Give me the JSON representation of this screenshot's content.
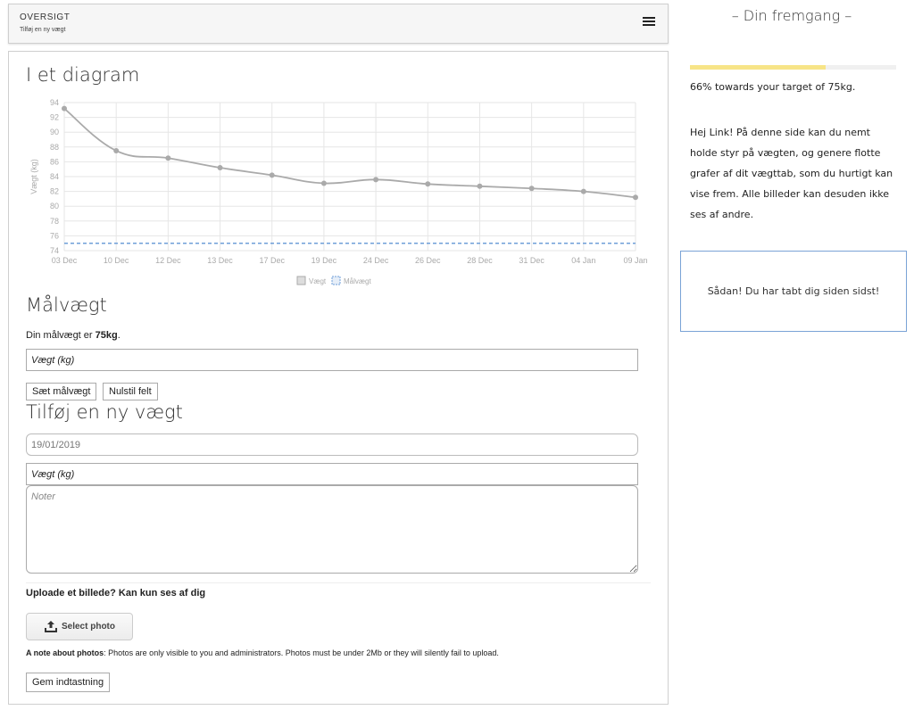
{
  "header": {
    "title": "OVERSIGT",
    "subtitle": "Tilføj en ny vægt"
  },
  "chart_section": {
    "title": "I et diagram"
  },
  "chart_data": {
    "type": "line",
    "ylabel": "Vægt (kg)",
    "ylim": [
      74,
      94
    ],
    "yticks": [
      74,
      76,
      78,
      80,
      82,
      84,
      86,
      88,
      90,
      92,
      94
    ],
    "categories": [
      "03 Dec",
      "10 Dec",
      "12 Dec",
      "13 Dec",
      "17 Dec",
      "19 Dec",
      "24 Dec",
      "26 Dec",
      "28 Dec",
      "31 Dec",
      "04 Jan",
      "09 Jan"
    ],
    "series": [
      {
        "name": "Vægt",
        "values": [
          93.2,
          87.5,
          86.5,
          85.2,
          84.2,
          83.1,
          83.6,
          83.0,
          82.7,
          82.4,
          82.0,
          81.2
        ],
        "color": "#aaaaaa"
      },
      {
        "name": "Målvægt",
        "values": [
          75,
          75,
          75,
          75,
          75,
          75,
          75,
          75,
          75,
          75,
          75,
          75
        ],
        "color": "#6f9fd8",
        "style": "dashed"
      }
    ],
    "grid": true,
    "legend_position": "bottom"
  },
  "goal": {
    "title": "Målvægt",
    "text_prefix": "Din målvægt er ",
    "value": "75kg",
    "text_suffix": ".",
    "input_placeholder": "Vægt (kg)",
    "set_button": "Sæt målvægt",
    "reset_button": "Nulstil felt"
  },
  "add_weight": {
    "title": "Tilføj en ny vægt",
    "date_value": "19/01/2019",
    "weight_placeholder": "Vægt (kg)",
    "notes_placeholder": "Noter",
    "upload_label": "Uploade et billede? Kan kun ses af dig",
    "photo_button": "Select photo",
    "note_bold": "A note about photos",
    "note_text": ": Photos are only visible to you and administrators. Photos must be under 2Mb or they will silently fail to upload.",
    "save_button": "Gem indtastning"
  },
  "sidebar": {
    "title": "– Din fremgang –",
    "progress_fraction": 0.66,
    "progress_text": "66% towards your target of 75kg.",
    "intro": "Hej Link! På denne side kan du nemt holde styr på vægten, og genere flotte grafer af dit vægttab, som du hurtigt kan vise frem. Alle billeder kan desuden ikke ses af andre.",
    "notice": "Sådan! Du har tabt dig siden sidst!"
  },
  "colors": {
    "progress": "#f7e487",
    "goal_line": "#6f9fd8",
    "series": "#aaaaaa",
    "notice_border": "#7aa3d6"
  },
  "icons": {
    "menu": "hamburger-icon",
    "upload": "upload-icon"
  }
}
